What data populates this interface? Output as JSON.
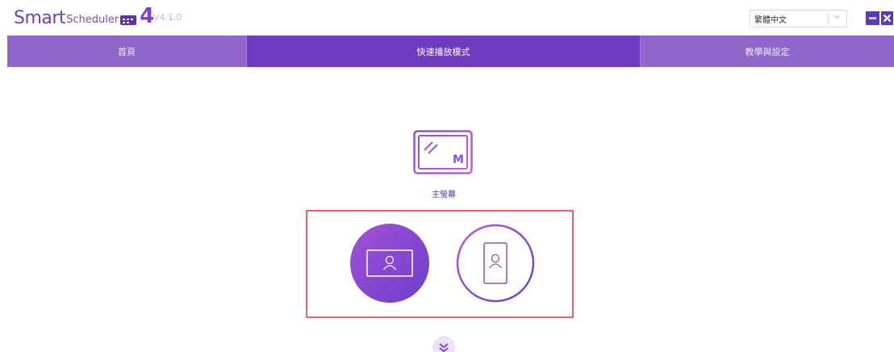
{
  "app": {
    "logo_main": "Smart",
    "logo_sub": "Scheduler",
    "logo_num": "4",
    "version": "V4.1.0"
  },
  "language": {
    "selected": "繁體中文"
  },
  "window_controls": {
    "minimize": "−",
    "close": "✕"
  },
  "nav": {
    "tabs": [
      {
        "label": "首頁",
        "active": false
      },
      {
        "label": "快速播放模式",
        "active": true
      },
      {
        "label": "教學與設定",
        "active": false
      }
    ]
  },
  "main": {
    "screen_label": "主螢幕",
    "screen_badge": "M",
    "modes": [
      {
        "name": "landscape",
        "selected": true
      },
      {
        "name": "portrait",
        "selected": false
      }
    ]
  },
  "colors": {
    "accent": "#6e3bc0",
    "nav_bg": "#8f67c8",
    "highlight_border": "#e8645e"
  },
  "icons": {
    "minimize": "minimize-icon",
    "close": "close-icon",
    "chevron": "chevron-down-icon",
    "screen": "monitor-icon",
    "expand": "double-chevron-down-icon"
  }
}
